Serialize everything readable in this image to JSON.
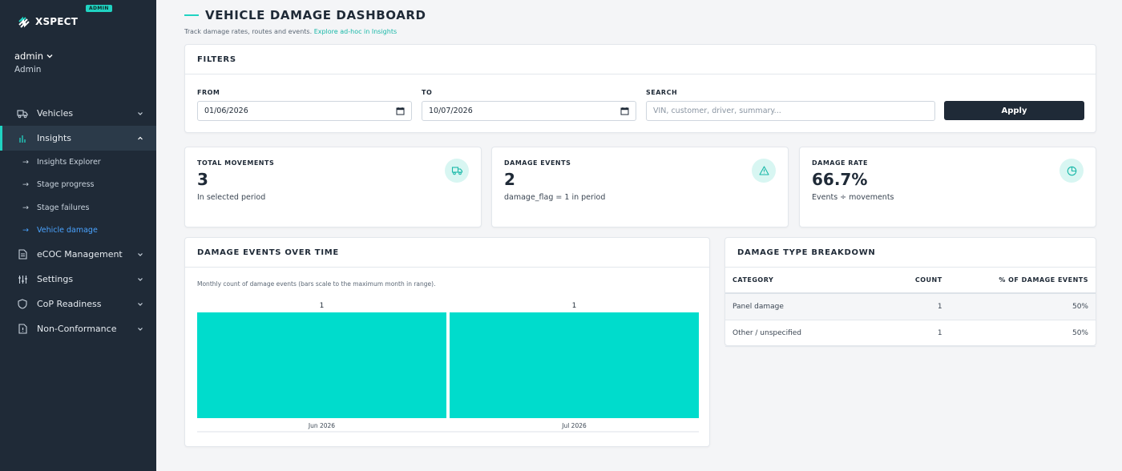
{
  "sidebar": {
    "logo_text": "XSPECT",
    "badge": "ADMIN",
    "user": {
      "name": "admin",
      "role": "Admin"
    },
    "nav": [
      {
        "label": "Vehicles",
        "icon": "truck-icon"
      },
      {
        "label": "Insights",
        "icon": "bar-chart-icon"
      },
      {
        "label": "eCOC Management",
        "icon": "document-icon"
      },
      {
        "label": "Settings",
        "icon": "sliders-icon"
      },
      {
        "label": "CoP Readiness",
        "icon": "shield-icon"
      },
      {
        "label": "Non-Conformance",
        "icon": "file-alert-icon"
      }
    ],
    "insights_sub": [
      {
        "label": "Insights Explorer"
      },
      {
        "label": "Stage progress"
      },
      {
        "label": "Stage failures"
      },
      {
        "label": "Vehicle damage"
      }
    ],
    "arrow": "→"
  },
  "page": {
    "title": "VEHICLE DAMAGE DASHBOARD",
    "subtitle": "Track damage rates, routes and events.",
    "subtitle_link": "Explore ad-hoc in Insights"
  },
  "filters": {
    "title": "FILTERS",
    "from_label": "FROM",
    "from_value": "01/06/2026",
    "to_label": "TO",
    "to_value": "10/07/2026",
    "search_label": "SEARCH",
    "search_placeholder": "VIN, customer, driver, summary...",
    "apply_label": "Apply"
  },
  "kpis": [
    {
      "label": "TOTAL MOVEMENTS",
      "value": "3",
      "note": "In selected period",
      "icon": "truck-icon"
    },
    {
      "label": "DAMAGE EVENTS",
      "value": "2",
      "note": "damage_flag = 1 in period",
      "icon": "warning-icon"
    },
    {
      "label": "DAMAGE RATE",
      "value": "66.7%",
      "note": "Events ÷ movements",
      "icon": "pie-icon"
    }
  ],
  "chart_panel": {
    "title": "DAMAGE EVENTS OVER TIME",
    "caption": "Monthly count of damage events (bars scale to the maximum month in range)."
  },
  "chart_data": {
    "type": "bar",
    "categories": [
      "Jun 2026",
      "Jul 2026"
    ],
    "values": [
      1,
      1
    ],
    "title": "DAMAGE EVENTS OVER TIME",
    "xlabel": "",
    "ylabel": "",
    "ylim": [
      0,
      1
    ],
    "grid": false,
    "bar_color": "#00dccc"
  },
  "breakdown": {
    "title": "DAMAGE TYPE BREAKDOWN",
    "headers": [
      "CATEGORY",
      "COUNT",
      "% OF DAMAGE EVENTS"
    ],
    "rows": [
      {
        "category": "Panel damage",
        "count": "1",
        "pct": "50%"
      },
      {
        "category": "Other / unspecified",
        "count": "1",
        "pct": "50%"
      }
    ]
  },
  "colors": {
    "accent": "#20d3c2",
    "sidebar": "#1f2a37",
    "link": "#4aa3ff"
  }
}
